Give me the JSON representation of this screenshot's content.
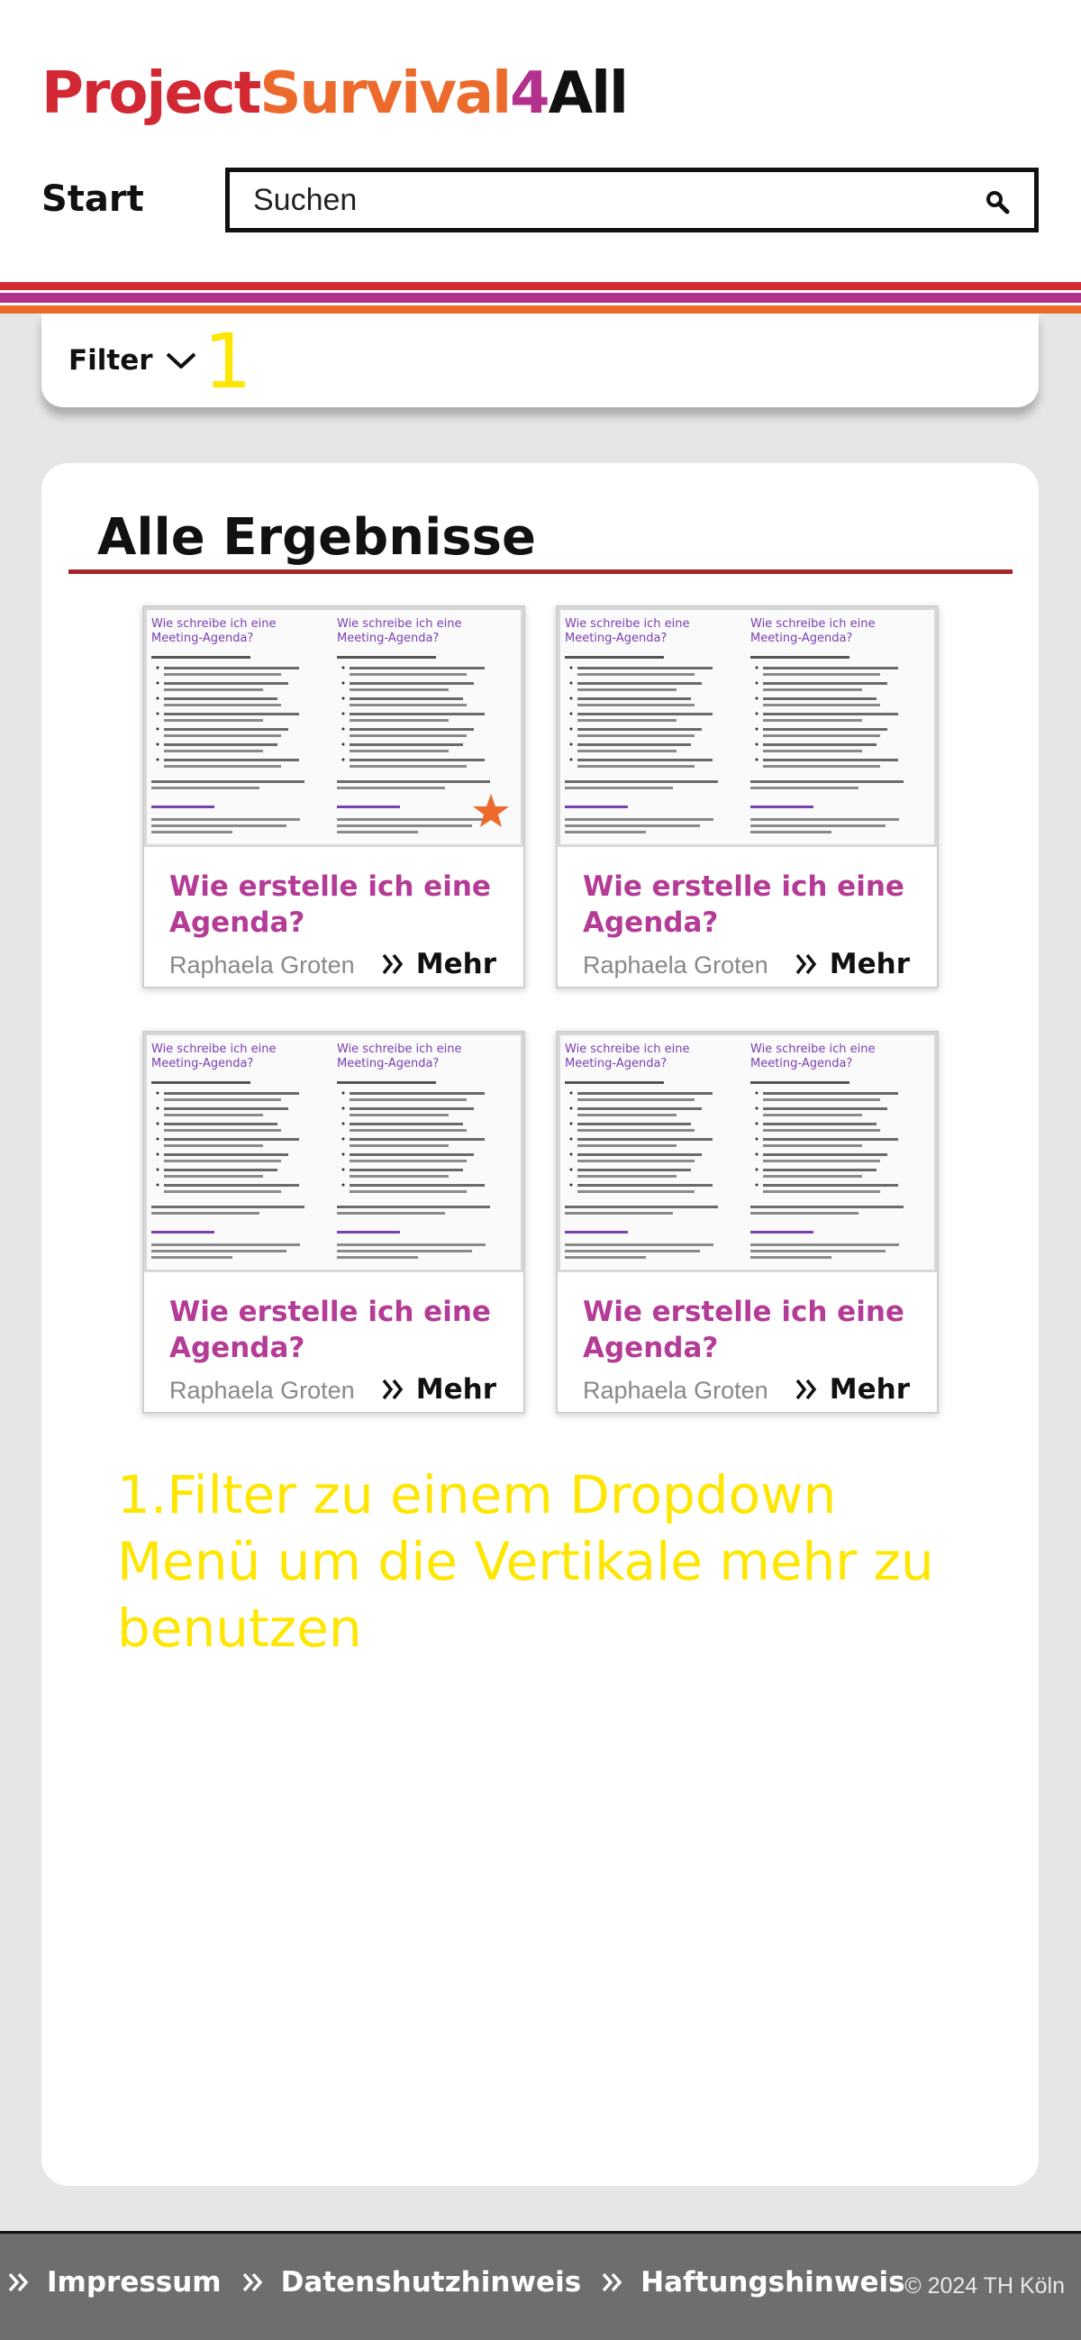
{
  "header": {
    "logo_parts": [
      "Project",
      "Survival",
      "4",
      "All"
    ],
    "nav_start": "Start",
    "search_placeholder": "Suchen"
  },
  "stripe_colors": [
    "#d12833",
    "#b2318c",
    "#ec6a2c"
  ],
  "filter": {
    "label": "Filter",
    "annotation_number": "1"
  },
  "results": {
    "title": "Alle Ergebnisse",
    "cards": [
      {
        "title": "Wie erstelle ich eine Agenda?",
        "author": "Raphaela Groten",
        "more_label": "Mehr",
        "starred": true
      },
      {
        "title": "Wie erstelle ich eine Agenda?",
        "author": "Raphaela Groten",
        "more_label": "Mehr",
        "starred": false
      },
      {
        "title": "Wie erstelle ich eine Agenda?",
        "author": "Raphaela Groten",
        "more_label": "Mehr",
        "starred": false
      },
      {
        "title": "Wie erstelle ich eine Agenda?",
        "author": "Raphaela Groten",
        "more_label": "Mehr",
        "starred": false
      }
    ]
  },
  "annotation": {
    "text": "1.Filter zu einem Dropdown Menü um die Vertikale mehr zu benutzen"
  },
  "footer": {
    "links": [
      "Impressum",
      "Datenshutzhinweis",
      "Haftungshinweis"
    ],
    "copyright": "© 2024 TH Köln"
  },
  "colors": {
    "brand_red": "#d12833",
    "brand_orange": "#ec6a2c",
    "brand_magenta": "#b2318c",
    "card_title": "#b43b96",
    "annotation_yellow": "#ffe600",
    "footer_bg": "#6e6e6e",
    "page_bg": "#e6e6e6"
  }
}
